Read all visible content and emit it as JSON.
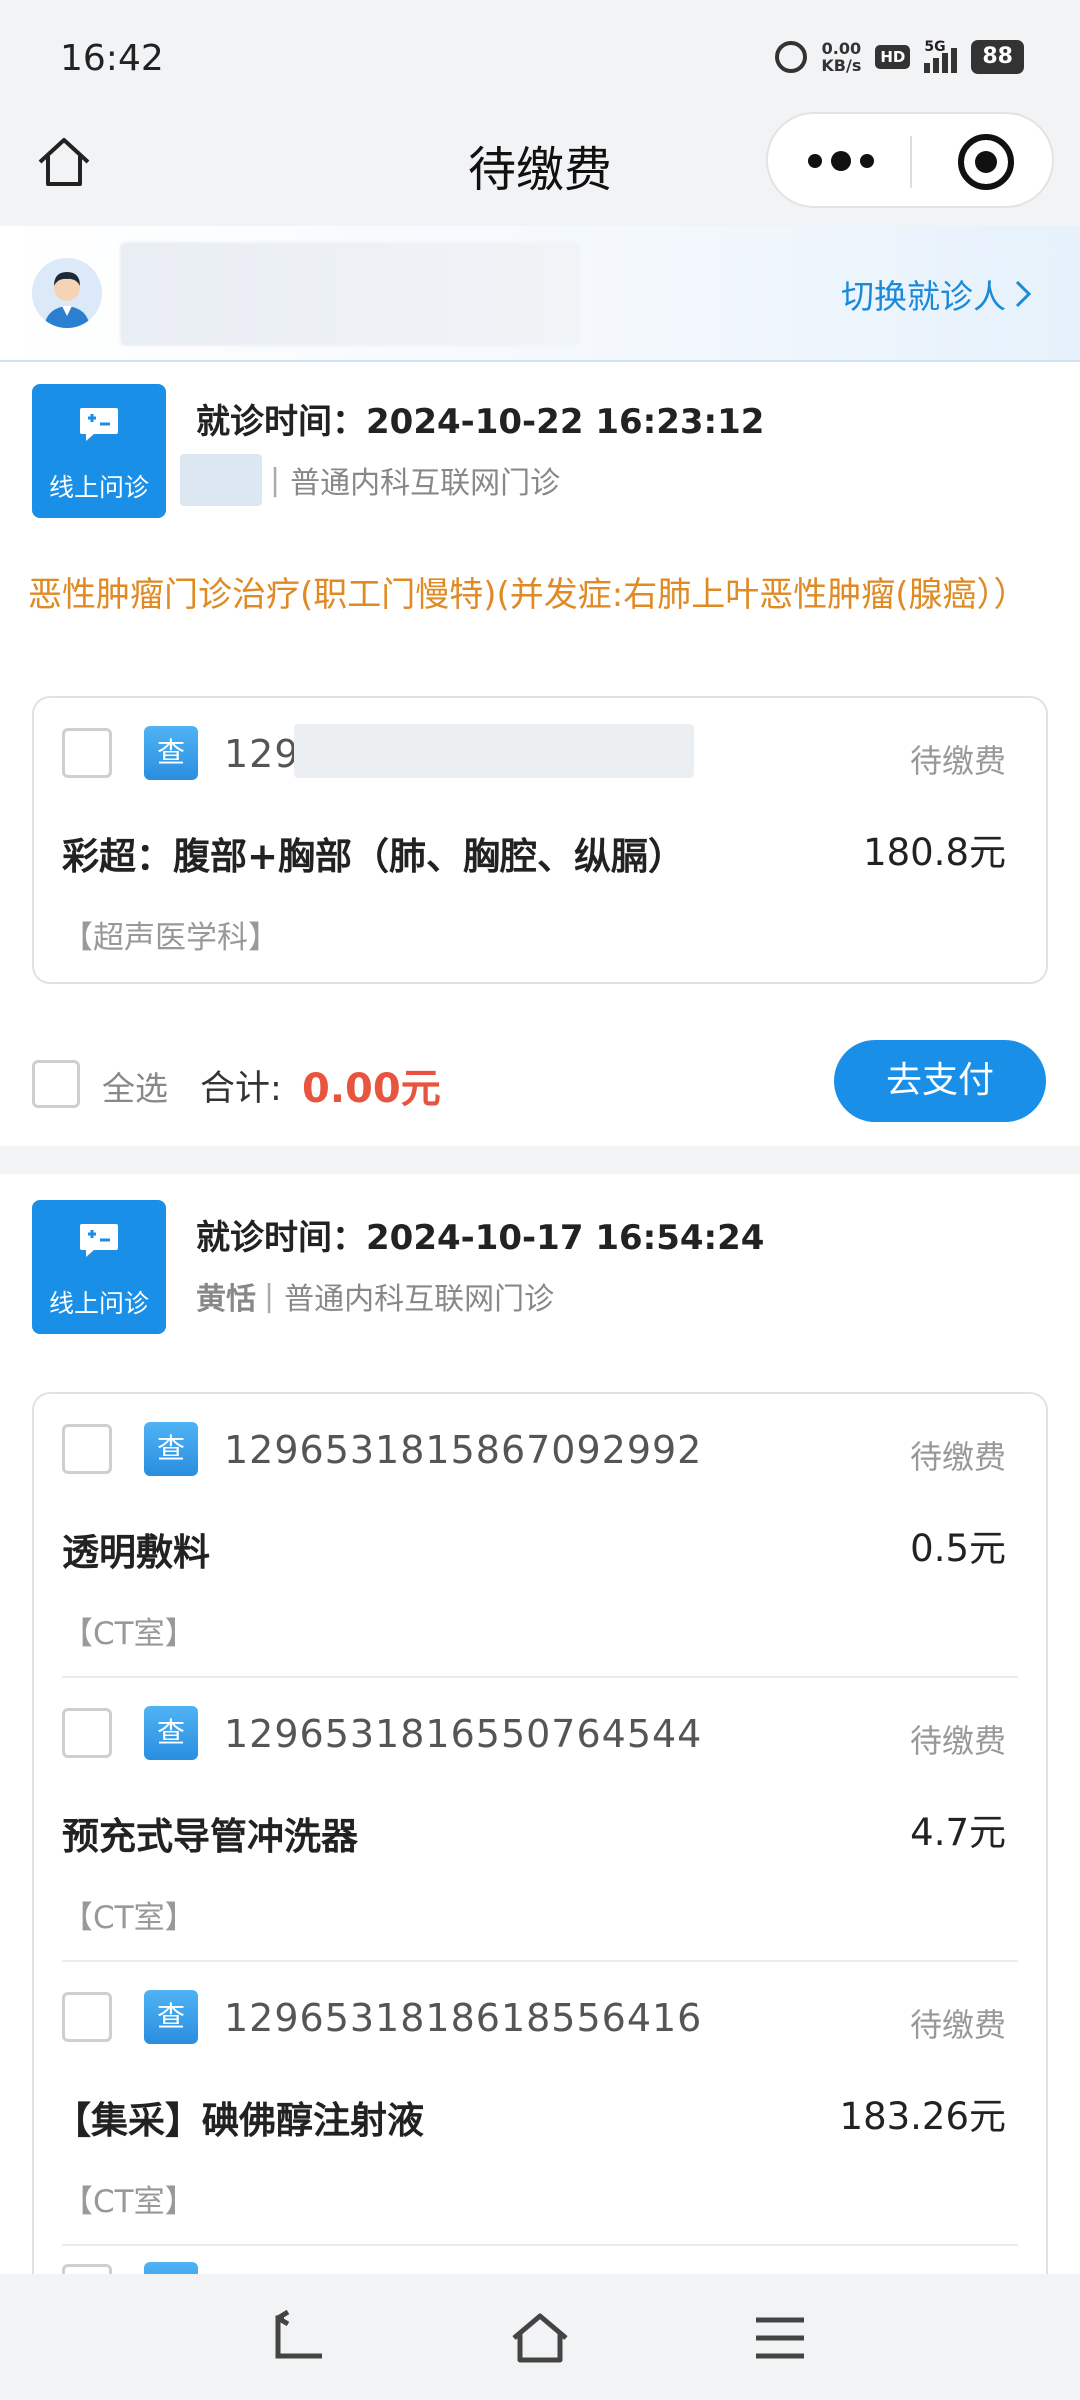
{
  "status_bar": {
    "time": "16:42",
    "speed_value": "0.00",
    "speed_unit": "KB/s",
    "hd": "HD",
    "network": "5G",
    "battery": "88",
    "icons": [
      "alarm-icon",
      "hd-icon",
      "signal-icon",
      "battery-icon"
    ]
  },
  "nav": {
    "title": "待缴费",
    "home_icon": "home-icon",
    "more_icon": "more-dots-icon",
    "target_icon": "target-icon"
  },
  "patient": {
    "switch_label": "切换就诊人",
    "switch_icon": "chevron-right-icon"
  },
  "visits": [
    {
      "badge_label": "线上问诊",
      "time": "就诊时间：2024-10-22 16:23:12",
      "doctor": "",
      "department": "普通内科互联网门诊",
      "diagnosis": "恶性肿瘤门诊治疗(职工门慢特)(并发症:右肺上叶恶性肿瘤(腺癌））",
      "items": [
        {
          "tag": "查",
          "order_no": "129",
          "status": "待缴费",
          "name": "彩超：腹部+胸部（肺、胸腔、纵膈）",
          "price": "180.8元",
          "dept": "【超声医学科】"
        }
      ],
      "select_all": "全选",
      "total_label": "合计:",
      "total_value": "0.00元",
      "pay_label": "去支付"
    },
    {
      "badge_label": "线上问诊",
      "time": "就诊时间：2024-10-17 16:54:24",
      "doctor": "黄恬",
      "department": "普通内科互联网门诊",
      "items": [
        {
          "tag": "查",
          "order_no": "1296531815867092992",
          "status": "待缴费",
          "name": "透明敷料",
          "price": "0.5元",
          "dept": "【CT室】"
        },
        {
          "tag": "查",
          "order_no": "1296531816550764544",
          "status": "待缴费",
          "name": "预充式导管冲洗器",
          "price": "4.7元",
          "dept": "【CT室】"
        },
        {
          "tag": "查",
          "order_no": "1296531818618556416",
          "status": "待缴费",
          "name": "【集采】碘佛醇注射液",
          "price": "183.26元",
          "dept": "【CT室】"
        }
      ]
    }
  ],
  "colors": {
    "primary": "#1a8fe8",
    "diagnosis": "#e08a24",
    "total": "#e8543e",
    "link": "#1a8ad9"
  },
  "system_nav": [
    "back-icon",
    "home-icon",
    "menu-icon"
  ]
}
